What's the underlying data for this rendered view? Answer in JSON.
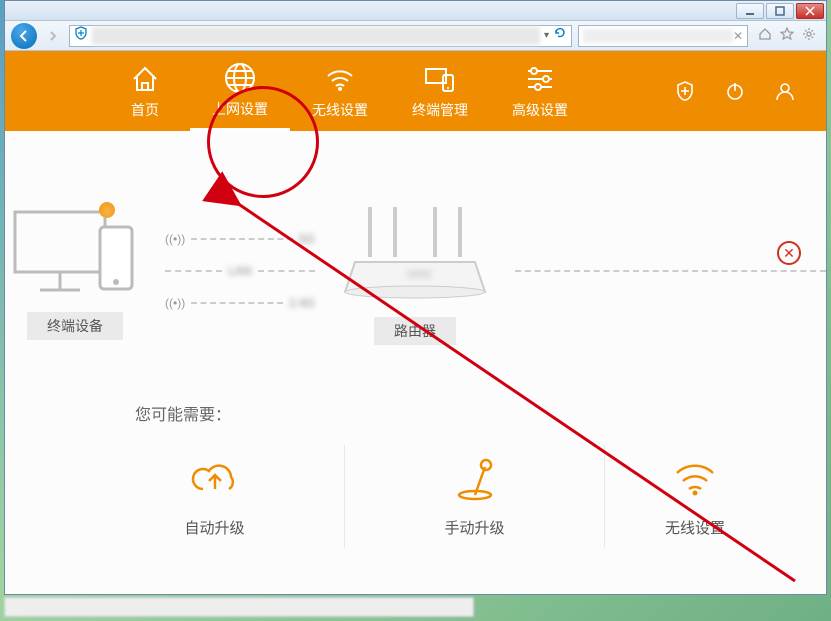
{
  "window": {
    "min": "▁",
    "max": "▢",
    "close": "✕"
  },
  "nav": {
    "home": "首页",
    "internet": "上网设置",
    "wireless": "无线设置",
    "terminal": "终端管理",
    "advanced": "高级设置"
  },
  "topology": {
    "device_label": "终端设备",
    "router_label": "路由器",
    "band_5g": "5G",
    "lan": "LAN",
    "band_24g": "2.4G",
    "error": "✕"
  },
  "section_title": "您可能需要：",
  "cards": {
    "auto_upgrade": "自动升级",
    "manual_upgrade": "手动升级",
    "wifi_partial": "无线设置"
  }
}
